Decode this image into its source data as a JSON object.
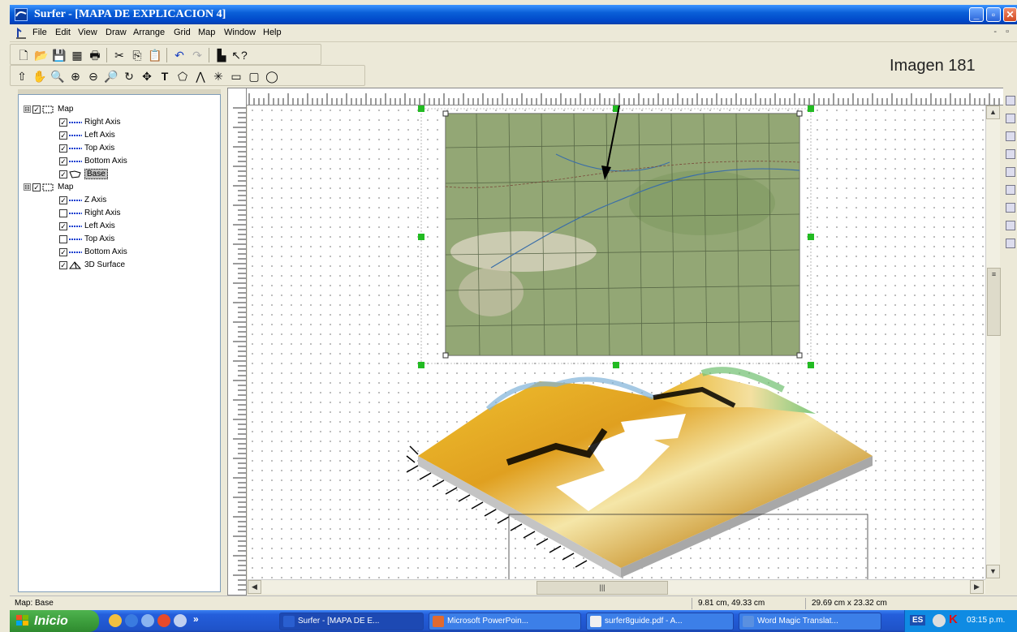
{
  "window": {
    "title": "Surfer - [MAPA DE EXPLICACION 4]",
    "min": "_",
    "max": "▫",
    "close": "✕"
  },
  "menu": [
    "File",
    "Edit",
    "View",
    "Draw",
    "Arrange",
    "Grid",
    "Map",
    "Window",
    "Help"
  ],
  "annotation": {
    "label": "Imagen 181"
  },
  "tree": [
    {
      "label": "Map",
      "level": 0,
      "expand": "⊟",
      "checked": true,
      "icon": "map-frame-icon"
    },
    {
      "label": "Right Axis",
      "level": 1,
      "checked": true,
      "icon": "axis-icon"
    },
    {
      "label": "Left Axis",
      "level": 1,
      "checked": true,
      "icon": "axis-icon"
    },
    {
      "label": "Top Axis",
      "level": 1,
      "checked": true,
      "icon": "axis-icon"
    },
    {
      "label": "Bottom Axis",
      "level": 1,
      "checked": true,
      "icon": "axis-icon"
    },
    {
      "label": "Base",
      "level": 1,
      "checked": true,
      "icon": "base-map-icon",
      "selected": true
    },
    {
      "label": "Map",
      "level": 0,
      "expand": "⊟",
      "checked": true,
      "icon": "map-frame-icon"
    },
    {
      "label": "Z Axis",
      "level": 1,
      "checked": true,
      "icon": "axis-icon"
    },
    {
      "label": "Right Axis",
      "level": 1,
      "checked": false,
      "icon": "axis-icon"
    },
    {
      "label": "Left Axis",
      "level": 1,
      "checked": true,
      "icon": "axis-icon"
    },
    {
      "label": "Top Axis",
      "level": 1,
      "checked": false,
      "icon": "axis-icon"
    },
    {
      "label": "Bottom Axis",
      "level": 1,
      "checked": true,
      "icon": "axis-icon"
    },
    {
      "label": "3D Surface",
      "level": 1,
      "checked": true,
      "icon": "surface-icon"
    }
  ],
  "status": {
    "selection": "Map: Base",
    "cursor": "9.81 cm, 49.33 cm",
    "size": "29.69 cm x 23.32 cm"
  },
  "taskbar": {
    "start": "Inicio",
    "tasks": [
      "Surfer - [MAPA DE E...",
      "Microsoft PowerPoin...",
      "surfer8guide.pdf - A...",
      "Word Magic Translat..."
    ],
    "lang": "ES",
    "clock": "03:15 p.m."
  },
  "colors": {
    "titlebar": "#0a5fd8",
    "taskbar": "#245edb",
    "start": "#3a9b3a",
    "selection_handle": "#22bb22"
  }
}
